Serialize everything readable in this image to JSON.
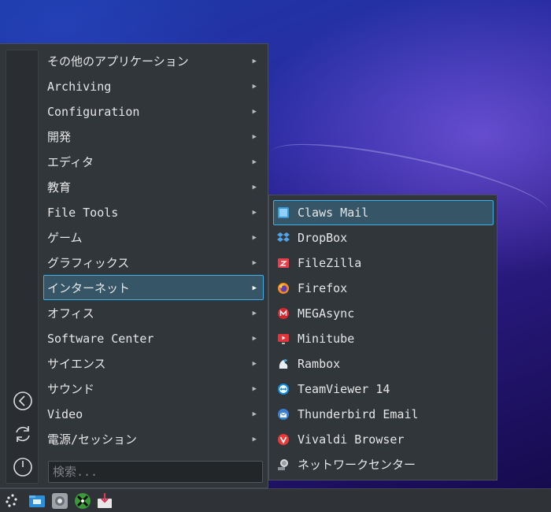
{
  "menu": {
    "items": [
      {
        "label": "その他のアプリケーション"
      },
      {
        "label": "Archiving"
      },
      {
        "label": "Configuration"
      },
      {
        "label": "開発"
      },
      {
        "label": "エディタ"
      },
      {
        "label": "教育"
      },
      {
        "label": "File Tools"
      },
      {
        "label": "ゲーム"
      },
      {
        "label": "グラフィックス"
      },
      {
        "label": "インターネット"
      },
      {
        "label": "オフィス"
      },
      {
        "label": "Software Center"
      },
      {
        "label": "サイエンス"
      },
      {
        "label": "サウンド"
      },
      {
        "label": "Video"
      },
      {
        "label": "電源/セッション"
      }
    ],
    "active_index": 9,
    "arrow_glyph": "▶",
    "search_placeholder": "検索..."
  },
  "sidebar": {
    "buttons": [
      "back-icon",
      "refresh-icon",
      "power-icon"
    ]
  },
  "submenu": {
    "items": [
      {
        "label": "Claws Mail",
        "icon": "claws-mail-icon",
        "color": "#3a9ad9"
      },
      {
        "label": "DropBox",
        "icon": "dropbox-icon",
        "color": "#4fa3e8"
      },
      {
        "label": "FileZilla",
        "icon": "filezilla-icon",
        "color": "#e5404a"
      },
      {
        "label": "Firefox",
        "icon": "firefox-icon",
        "color": "#f28a1e"
      },
      {
        "label": "MEGAsync",
        "icon": "megasync-icon",
        "color": "#d9272e"
      },
      {
        "label": "Minitube",
        "icon": "minitube-icon",
        "color": "#e0353a"
      },
      {
        "label": "Rambox",
        "icon": "rambox-icon",
        "color": "#4aa0d9"
      },
      {
        "label": "TeamViewer 14",
        "icon": "teamviewer-icon",
        "color": "#0e8ee9"
      },
      {
        "label": "Thunderbird Email",
        "icon": "thunderbird-icon",
        "color": "#3b7fd1"
      },
      {
        "label": "Vivaldi Browser",
        "icon": "vivaldi-icon",
        "color": "#ef3939"
      },
      {
        "label": "ネットワークセンター",
        "icon": "network-center-icon",
        "color": "#c8c8c8"
      }
    ],
    "active_index": 0
  },
  "taskbar": {
    "items": [
      "start-menu-icon",
      "file-manager-icon",
      "settings-icon",
      "xfburn-icon",
      "installer-icon"
    ]
  },
  "colors": {
    "accent": "#3daee9",
    "highlight": "#365567",
    "panel": "#31363b"
  }
}
